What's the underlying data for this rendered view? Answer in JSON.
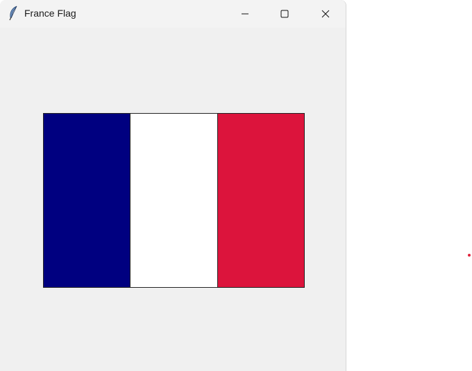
{
  "window": {
    "title": "France Flag",
    "app_icon": "feather-icon",
    "controls": {
      "minimize_icon": "minimize-icon",
      "maximize_icon": "maximize-icon",
      "close_icon": "close-icon"
    }
  },
  "flag": {
    "stripes": [
      {
        "name": "blue",
        "color": "#000080"
      },
      {
        "name": "white",
        "color": "#ffffff"
      },
      {
        "name": "red",
        "color": "#dc143c"
      }
    ]
  },
  "marker": {
    "color": "#e0243c"
  }
}
